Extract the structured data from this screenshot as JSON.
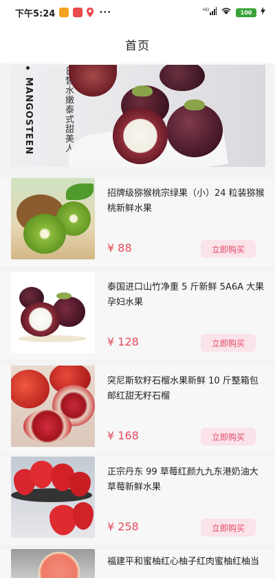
{
  "status_bar": {
    "time": "下午5:24",
    "dots": "···",
    "network": "HD",
    "battery": "100"
  },
  "nav": {
    "title": "首页"
  },
  "banner": {
    "tagline": "日皙水嫩泰式甜美人",
    "brand": "MANGOSTEEN"
  },
  "products": [
    {
      "name": "招牌级猕猴桃宗绿果（小）24 粒装猕猴桃新鲜水果",
      "price": "¥ 88",
      "buy_label": "立即购买"
    },
    {
      "name": "泰国进口山竹净重 5 斤新鲜 5A6A 大果孕妇水果",
      "price": "¥ 128",
      "buy_label": "立即购买"
    },
    {
      "name": "突尼斯软籽石榴水果新鲜 10 斤整箱包邮红甜无籽石榴",
      "price": "¥ 168",
      "buy_label": "立即购买"
    },
    {
      "name": "正宗丹东 99 草莓红颜九九东港奶油大草莓新鲜水果",
      "price": "¥ 258",
      "buy_label": "立即购买"
    },
    {
      "name": "福建平和蜜柚红心柚子红肉蜜柚红柚当",
      "price": "",
      "buy_label": ""
    }
  ]
}
